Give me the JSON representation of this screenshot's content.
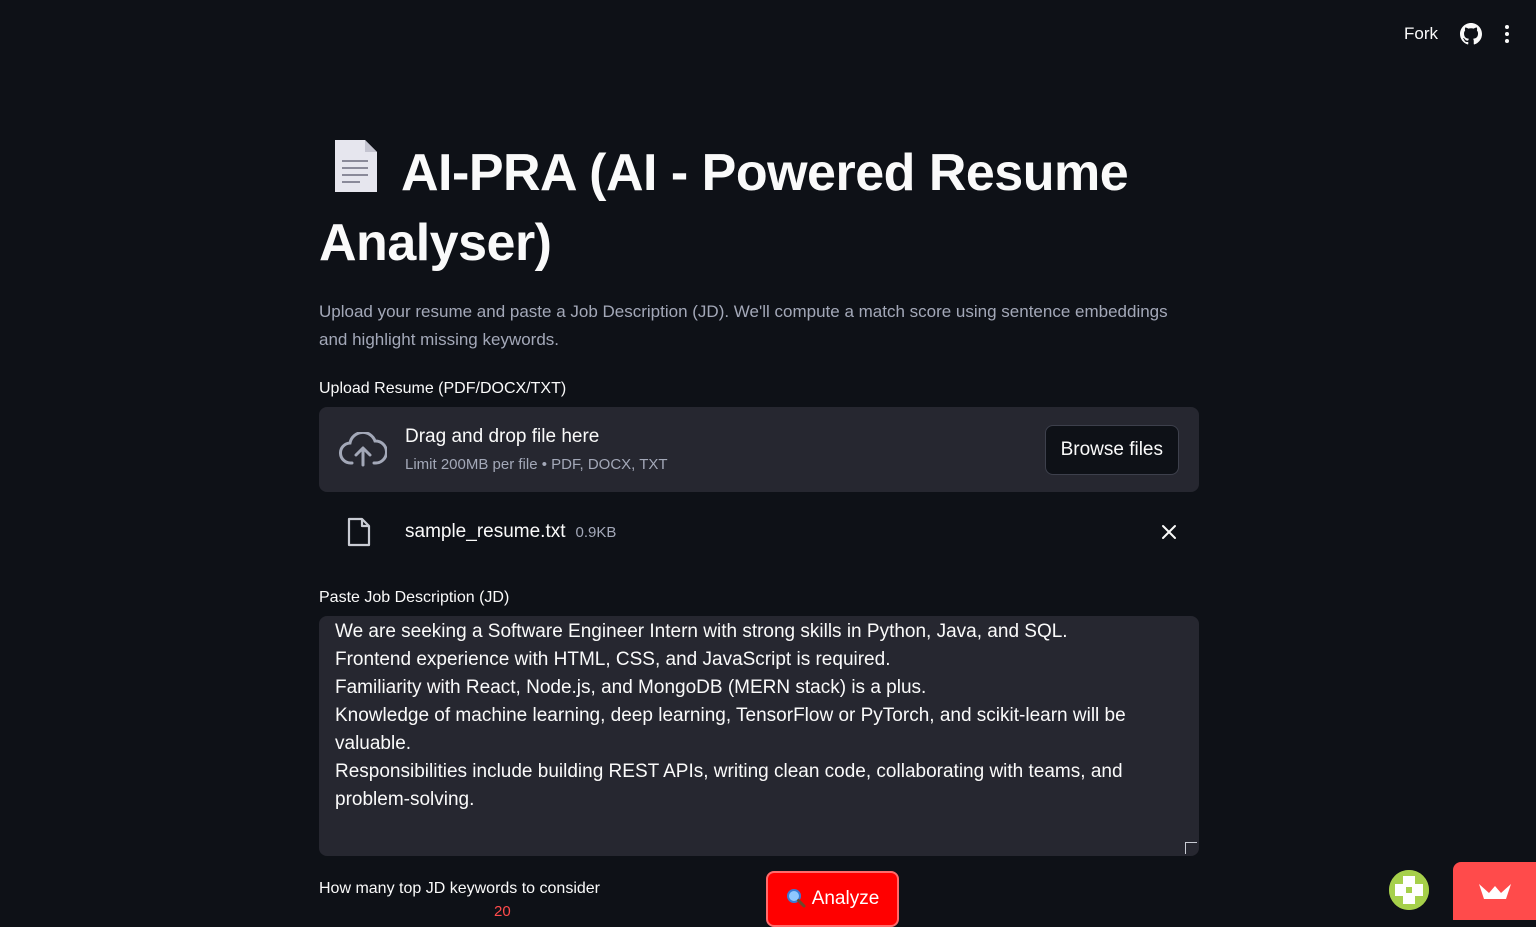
{
  "header": {
    "fork_label": "Fork",
    "github_icon": "github-icon",
    "menu_icon": "more-vertical-icon"
  },
  "main": {
    "title_icon": "document-emoji",
    "title": "AI-PRA (AI - Powered Resume Analyser)",
    "subtitle": "Upload your resume and paste a Job Description (JD). We'll compute a match score using sentence embeddings and highlight missing keywords."
  },
  "uploader": {
    "label": "Upload Resume (PDF/DOCX/TXT)",
    "drop_title": "Drag and drop file here",
    "drop_limit": "Limit 200MB per file • PDF, DOCX, TXT",
    "browse_label": "Browse files",
    "file": {
      "name": "sample_resume.txt",
      "size": "0.9KB"
    }
  },
  "jd": {
    "label": "Paste Job Description (JD)",
    "text": "We are seeking a Software Engineer Intern with strong skills in Python, Java, and SQL.\nFrontend experience with HTML, CSS, and JavaScript is required.\nFamiliarity with React, Node.js, and MongoDB (MERN stack) is a plus.\nKnowledge of machine learning, deep learning, TensorFlow or PyTorch, and scikit-learn will be valuable.\nResponsibilities include building REST APIs, writing clean code, collaborating with teams, and problem-solving."
  },
  "keywords": {
    "label": "How many top JD keywords to consider",
    "value": "20"
  },
  "analyze": {
    "icon": "magnifier-emoji",
    "label": "Analyze"
  },
  "colors": {
    "background": "#0e1117",
    "panel": "#262730",
    "accent": "#ff4b4b",
    "analyze_button": "#ff0000"
  }
}
